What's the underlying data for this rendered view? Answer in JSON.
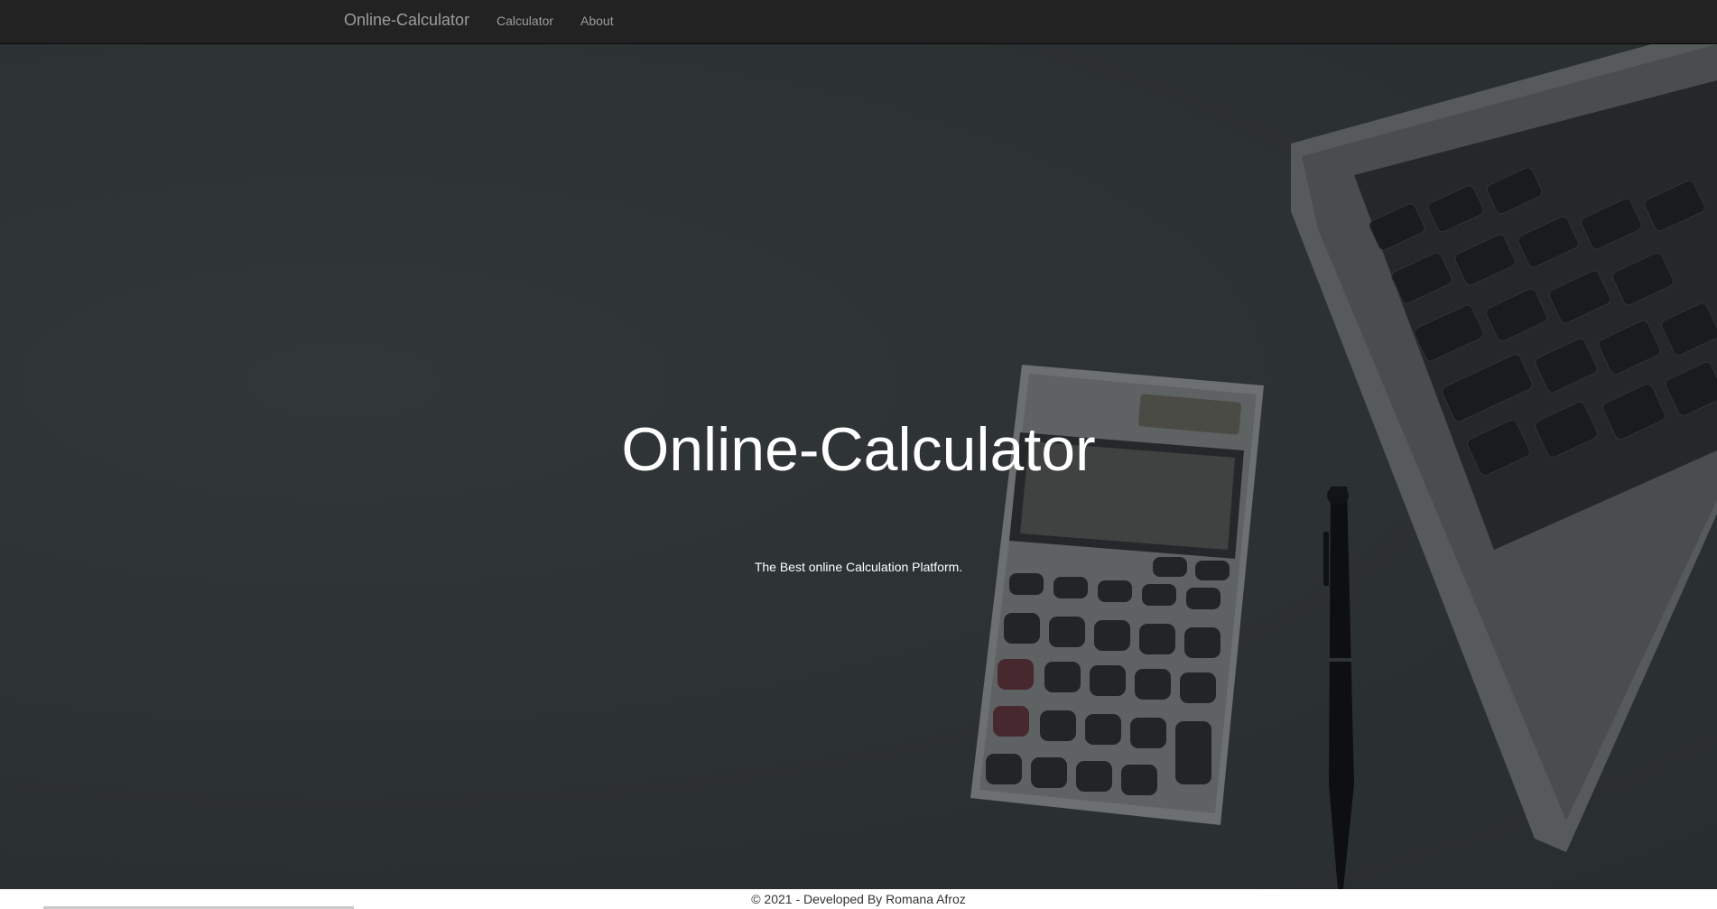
{
  "colors": {
    "navbar_bg": "#222222",
    "nav_text": "#9d9d9d",
    "hero_text": "#ffffff",
    "footer_text": "#333333"
  },
  "navbar": {
    "brand": "Online-Calculator",
    "links": [
      {
        "label": "Calculator"
      },
      {
        "label": "About"
      }
    ]
  },
  "hero": {
    "title": "Online-Calculator",
    "subtitle": "The Best online Calculation Platform.",
    "background_icons": [
      "laptop-image",
      "calculator-image",
      "pen-image"
    ]
  },
  "footer": {
    "text": "© 2021 - Developed By Romana Afroz"
  }
}
